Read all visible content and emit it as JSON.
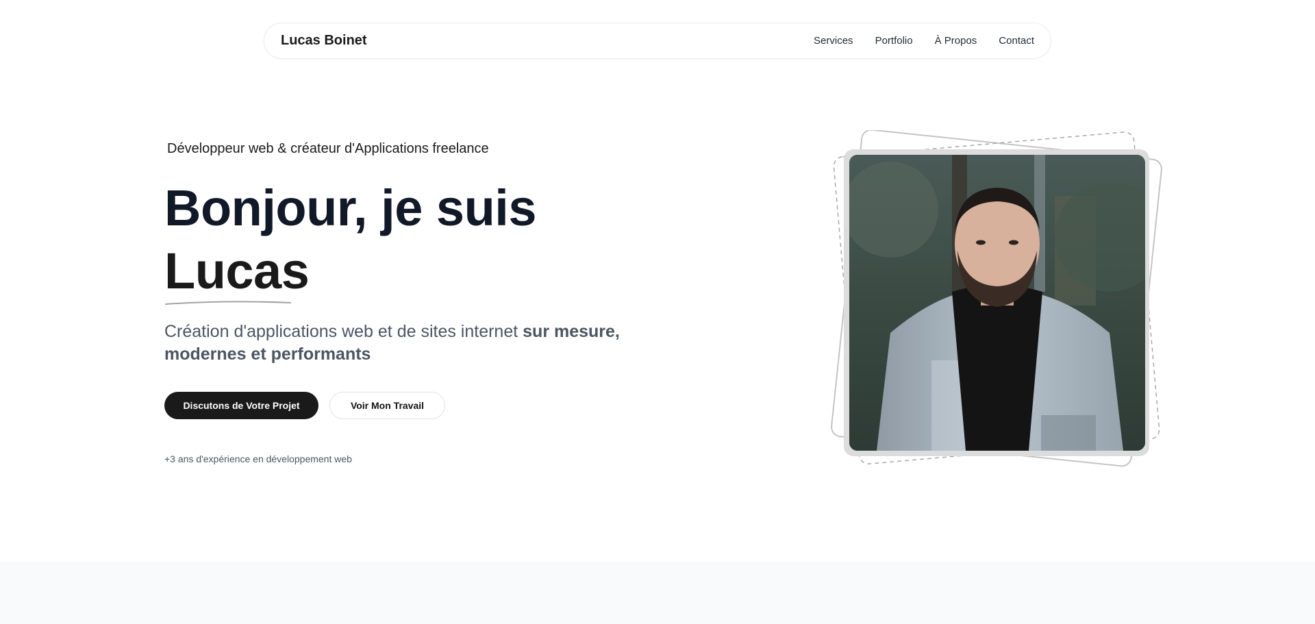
{
  "nav": {
    "brand": "Lucas Boinet",
    "links": [
      "Services",
      "Portfolio",
      "À Propos",
      "Contact"
    ]
  },
  "hero": {
    "tagline": "Développeur web & créateur d'Applications freelance",
    "headline_line1": "Bonjour, je suis",
    "headline_name": "Lucas",
    "subtitle_plain": "Création d'applications web et de sites internet ",
    "subtitle_bold_1": "sur mesure,",
    "subtitle_bold_2": "modernes et performants",
    "primary_button": "Discutons de Votre Projet",
    "secondary_button": "Voir Mon Travail",
    "experience": "+3 ans d'expérience en développement web"
  },
  "colors": {
    "primary": "#1a1a1a",
    "text_muted": "#4b5563",
    "band": "#f9fafb"
  },
  "icons": {
    "photo": "portrait-photo"
  }
}
